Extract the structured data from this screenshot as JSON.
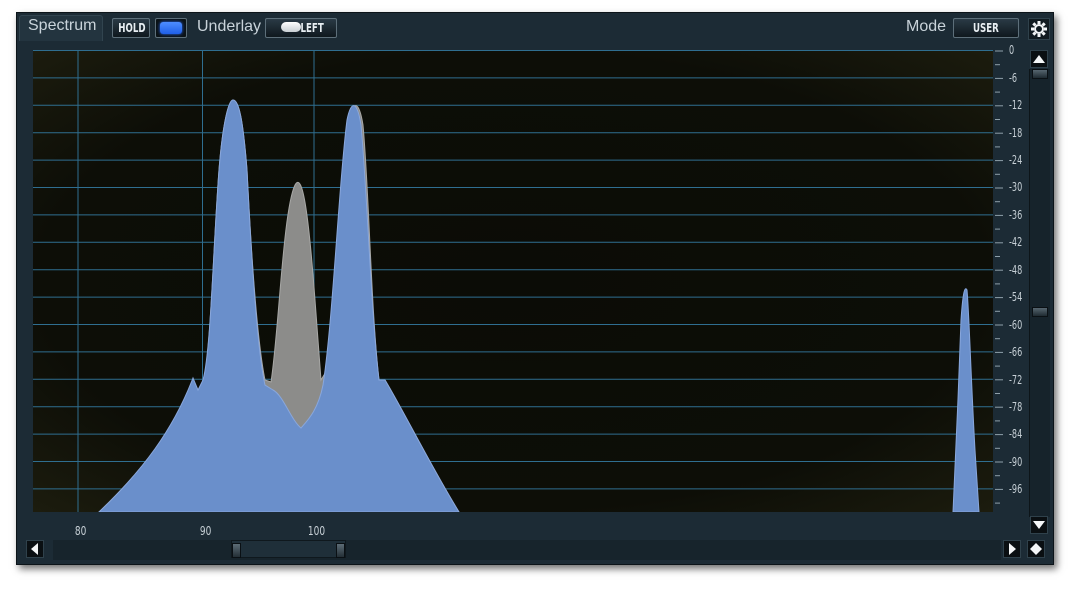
{
  "toolbar": {
    "spectrum_tab": "Spectrum",
    "hold_label": "HOLD",
    "hold_led_on": true,
    "underlay_label": "Underlay",
    "underlay_value": "LEFT",
    "mode_label": "Mode",
    "mode_value": "USER"
  },
  "colors": {
    "panel": "#1c2b35",
    "plot_bg": "#0d0e07",
    "grid": "#2f6e90",
    "spectrum_fill": "#6a8fcb",
    "underlay_fill": "#8b8b8b",
    "accent_led": "#2a6cff"
  },
  "icons": {
    "settings": "gear-icon",
    "scroll_up": "arrow-up-icon",
    "scroll_down": "arrow-down-icon",
    "scroll_left": "arrow-left-icon",
    "scroll_right": "arrow-right-icon",
    "zoom": "diamond-icon"
  },
  "axes": {
    "y_ticks": [
      "0",
      "-6",
      "-12",
      "-18",
      "-24",
      "-30",
      "-36",
      "-42",
      "-48",
      "-54",
      "-60",
      "-66",
      "-72",
      "-78",
      "-84",
      "-90",
      "-96"
    ],
    "y_range": [
      0,
      -100
    ],
    "x_ticks": [
      "80",
      "90",
      "100"
    ]
  },
  "scroll": {
    "vertical_thumb_range": [
      0,
      0.57
    ],
    "horizontal_thumb_range": [
      0.21,
      0.33
    ]
  }
}
